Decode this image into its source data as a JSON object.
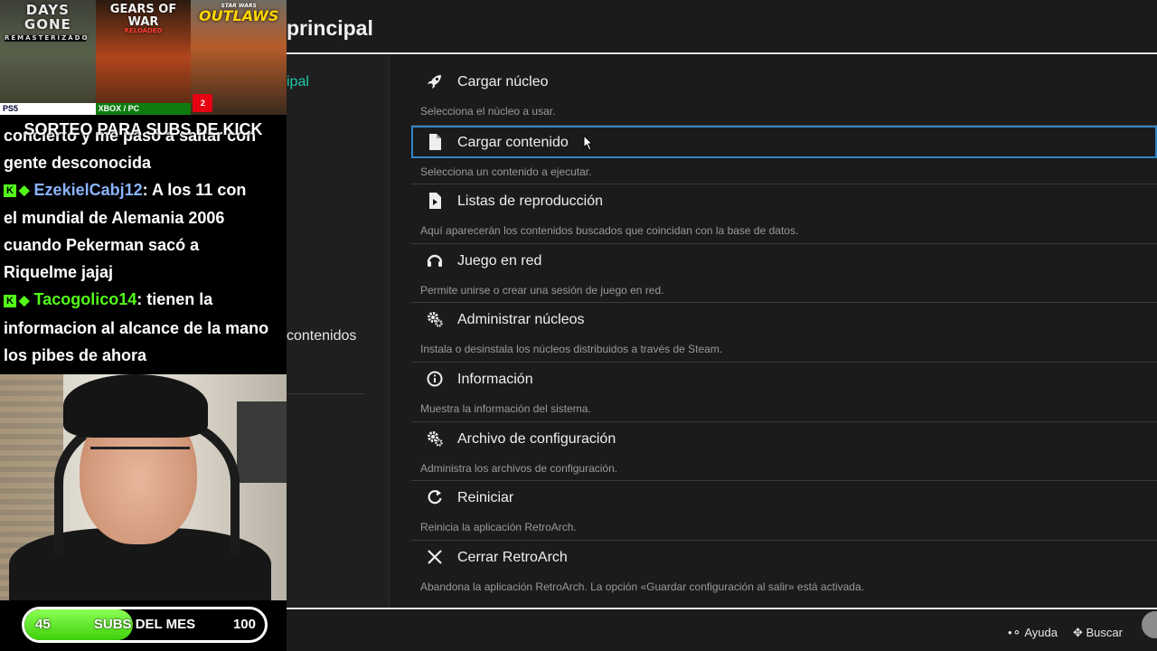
{
  "overlay": {
    "covers": [
      {
        "title": "DAYS GONE",
        "subtitle": "REMASTERIZADO",
        "platform": "PS5"
      },
      {
        "title": "GEARS OF WAR",
        "subtitle": "RELOADED",
        "platform": "XBOX / PC"
      },
      {
        "title": "OUTLAWS",
        "subtitle": "STAR WARS",
        "platform": "2"
      }
    ],
    "raffle_text": "SORTEO PARA SUBS DE KICK",
    "chat": {
      "lines": [
        {
          "text": "concierto y me pasó a saltar con"
        },
        {
          "text": "gente desconocida"
        },
        {
          "user": "EzekielCabj12",
          "message": ": A los 11 con"
        },
        {
          "text": "el mundial de Alemania 2006"
        },
        {
          "text": "cuando Pekerman sacó a"
        },
        {
          "text": "Riquelme jajaj"
        },
        {
          "user": "Tacogolico14",
          "message": ": tienen la"
        },
        {
          "text": "informacion al alcance de la mano"
        },
        {
          "text": "los pibes de ahora"
        }
      ],
      "badge": "K"
    },
    "subs_goal": {
      "start": "45",
      "label": "SUBS DEL MES",
      "end": "100",
      "progress": 0.45
    }
  },
  "retroarch": {
    "title": "principal",
    "sidebar": {
      "main": "ipal",
      "content": "contenidos"
    },
    "menu": [
      {
        "icon": "rocket-icon",
        "label": "Cargar núcleo",
        "desc": "Selecciona el núcleo a usar."
      },
      {
        "icon": "file-icon",
        "label": "Cargar contenido",
        "desc": "Selecciona un contenido a ejecutar.",
        "selected": true
      },
      {
        "icon": "playlist-icon",
        "label": "Listas de reproducción",
        "desc": "Aquí aparecerán los contenidos buscados que coincidan con la base de datos."
      },
      {
        "icon": "headset-icon",
        "label": "Juego en red",
        "desc": "Permite unirse o crear una sesión de juego en red."
      },
      {
        "icon": "gears-icon",
        "label": "Administrar núcleos",
        "desc": "Instala o desinstala los núcleos distribuidos a través de Steam."
      },
      {
        "icon": "info-icon",
        "label": "Información",
        "desc": "Muestra la información del sistema."
      },
      {
        "icon": "gears-icon",
        "label": "Archivo de configuración",
        "desc": "Administra los archivos de configuración."
      },
      {
        "icon": "restart-icon",
        "label": "Reiniciar",
        "desc": "Reinicia la aplicación RetroArch."
      },
      {
        "icon": "close-icon",
        "label": "Cerrar RetroArch",
        "desc": "Abandona la aplicación RetroArch. La opción «Guardar configuración al salir» está activada."
      }
    ],
    "footer": {
      "help": "Ayuda",
      "search": "Buscar"
    }
  }
}
